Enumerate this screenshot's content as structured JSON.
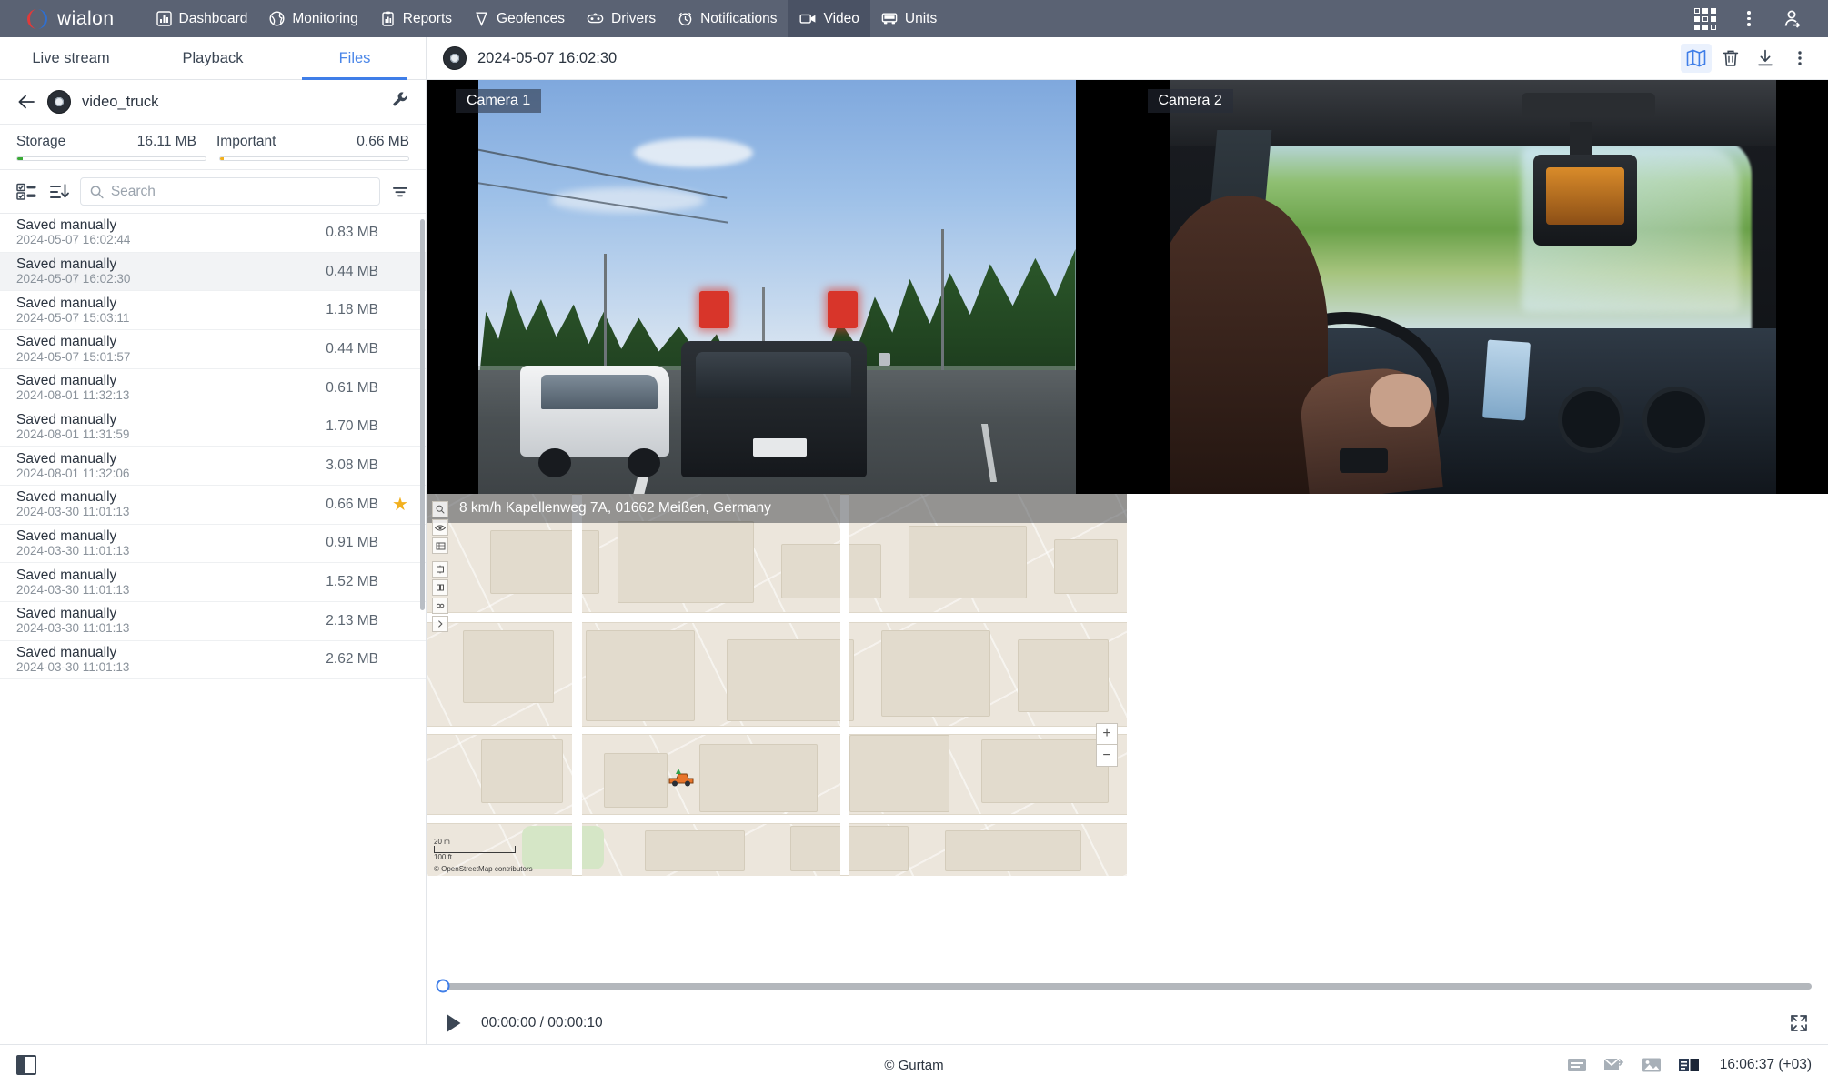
{
  "topnav": {
    "brand": "wialon",
    "items": [
      {
        "label": "Dashboard",
        "icon": "dashboard-icon",
        "active": false
      },
      {
        "label": "Monitoring",
        "icon": "monitoring-icon",
        "active": false
      },
      {
        "label": "Reports",
        "icon": "reports-icon",
        "active": false
      },
      {
        "label": "Geofences",
        "icon": "geofences-icon",
        "active": false
      },
      {
        "label": "Drivers",
        "icon": "drivers-icon",
        "active": false
      },
      {
        "label": "Notifications",
        "icon": "notifications-icon",
        "active": false
      },
      {
        "label": "Video",
        "icon": "video-icon",
        "active": true
      },
      {
        "label": "Units",
        "icon": "units-icon",
        "active": false
      }
    ],
    "apps_icon": "apps-grid-icon",
    "more_icon": "more-vertical-icon",
    "user_icon": "user-logout-icon"
  },
  "sidebar": {
    "tabs": [
      {
        "label": "Live stream",
        "active": false
      },
      {
        "label": "Playback",
        "active": false
      },
      {
        "label": "Files",
        "active": true
      }
    ],
    "unit": {
      "back_icon": "back-arrow-icon",
      "avatar_icon": "tire-avatar-icon",
      "name": "video_truck",
      "settings_icon": "wrench-icon"
    },
    "storage": {
      "storage_label": "Storage",
      "storage_value": "16.11 MB",
      "important_label": "Important",
      "important_value": "0.66 MB",
      "storage_fill_percent": 3,
      "storage_fill_color": "#3aaa35",
      "important_fill_percent": 2,
      "important_fill_color": "#f2b01e"
    },
    "toolbar": {
      "select_icon": "select-all-icon",
      "sort_icon": "sort-descending-icon",
      "filter_icon": "filter-icon"
    },
    "search": {
      "value": "",
      "placeholder": "Search",
      "icon": "search-icon"
    },
    "files": [
      {
        "title": "Saved manually",
        "date": "2024-05-07 16:02:44",
        "size": "0.83 MB",
        "starred": false,
        "selected": false
      },
      {
        "title": "Saved manually",
        "date": "2024-05-07 16:02:30",
        "size": "0.44 MB",
        "starred": false,
        "selected": true
      },
      {
        "title": "Saved manually",
        "date": "2024-05-07 15:03:11",
        "size": "1.18 MB",
        "starred": false,
        "selected": false
      },
      {
        "title": "Saved manually",
        "date": "2024-05-07 15:01:57",
        "size": "0.44 MB",
        "starred": false,
        "selected": false
      },
      {
        "title": "Saved manually",
        "date": "2024-08-01 11:32:13",
        "size": "0.61 MB",
        "starred": false,
        "selected": false
      },
      {
        "title": "Saved manually",
        "date": "2024-08-01 11:31:59",
        "size": "1.70 MB",
        "starred": false,
        "selected": false
      },
      {
        "title": "Saved manually",
        "date": "2024-08-01 11:32:06",
        "size": "3.08 MB",
        "starred": false,
        "selected": false
      },
      {
        "title": "Saved manually",
        "date": "2024-03-30 11:01:13",
        "size": "0.66 MB",
        "starred": true,
        "selected": false
      },
      {
        "title": "Saved manually",
        "date": "2024-03-30 11:01:13",
        "size": "0.91 MB",
        "starred": false,
        "selected": false
      },
      {
        "title": "Saved manually",
        "date": "2024-03-30 11:01:13",
        "size": "1.52 MB",
        "starred": false,
        "selected": false
      },
      {
        "title": "Saved manually",
        "date": "2024-03-30 11:01:13",
        "size": "2.13 MB",
        "starred": false,
        "selected": false
      },
      {
        "title": "Saved manually",
        "date": "2024-03-30 11:01:13",
        "size": "2.62 MB",
        "starred": false,
        "selected": false
      }
    ]
  },
  "main": {
    "header": {
      "avatar_icon": "tire-avatar-icon",
      "title": "2024-05-07 16:02:30",
      "actions": [
        {
          "icon": "map-icon",
          "active": true
        },
        {
          "icon": "trash-icon",
          "active": false
        },
        {
          "icon": "download-icon",
          "active": false
        },
        {
          "icon": "more-vertical-icon",
          "active": false
        }
      ]
    },
    "cameras": [
      {
        "label": "Camera 1"
      },
      {
        "label": "Camera 2"
      }
    ],
    "map": {
      "overlay_text": "8 km/h Kapellenweg 7A, 01662 Meißen, Germany",
      "zoom_in": "+",
      "zoom_out": "−",
      "scale_metric": "20 m",
      "scale_imperial": "100 ft",
      "attribution": "© OpenStreetMap contributors"
    },
    "player": {
      "play_icon": "play-icon",
      "current_time": "00:00:00",
      "separator": "/",
      "total_time": "00:00:10",
      "time_display": "00:00:00 / 00:00:10",
      "progress_percent": 0,
      "fullscreen_icon": "fullscreen-icon"
    }
  },
  "footer": {
    "panel_toggle_icon": "panel-toggle-icon",
    "copyright": "© Gurtam",
    "icons": [
      {
        "icon": "messages-icon"
      },
      {
        "icon": "mail-send-icon"
      },
      {
        "icon": "image-icon"
      },
      {
        "icon": "layout-icon"
      }
    ],
    "clock": "16:06:37 (+03)"
  }
}
